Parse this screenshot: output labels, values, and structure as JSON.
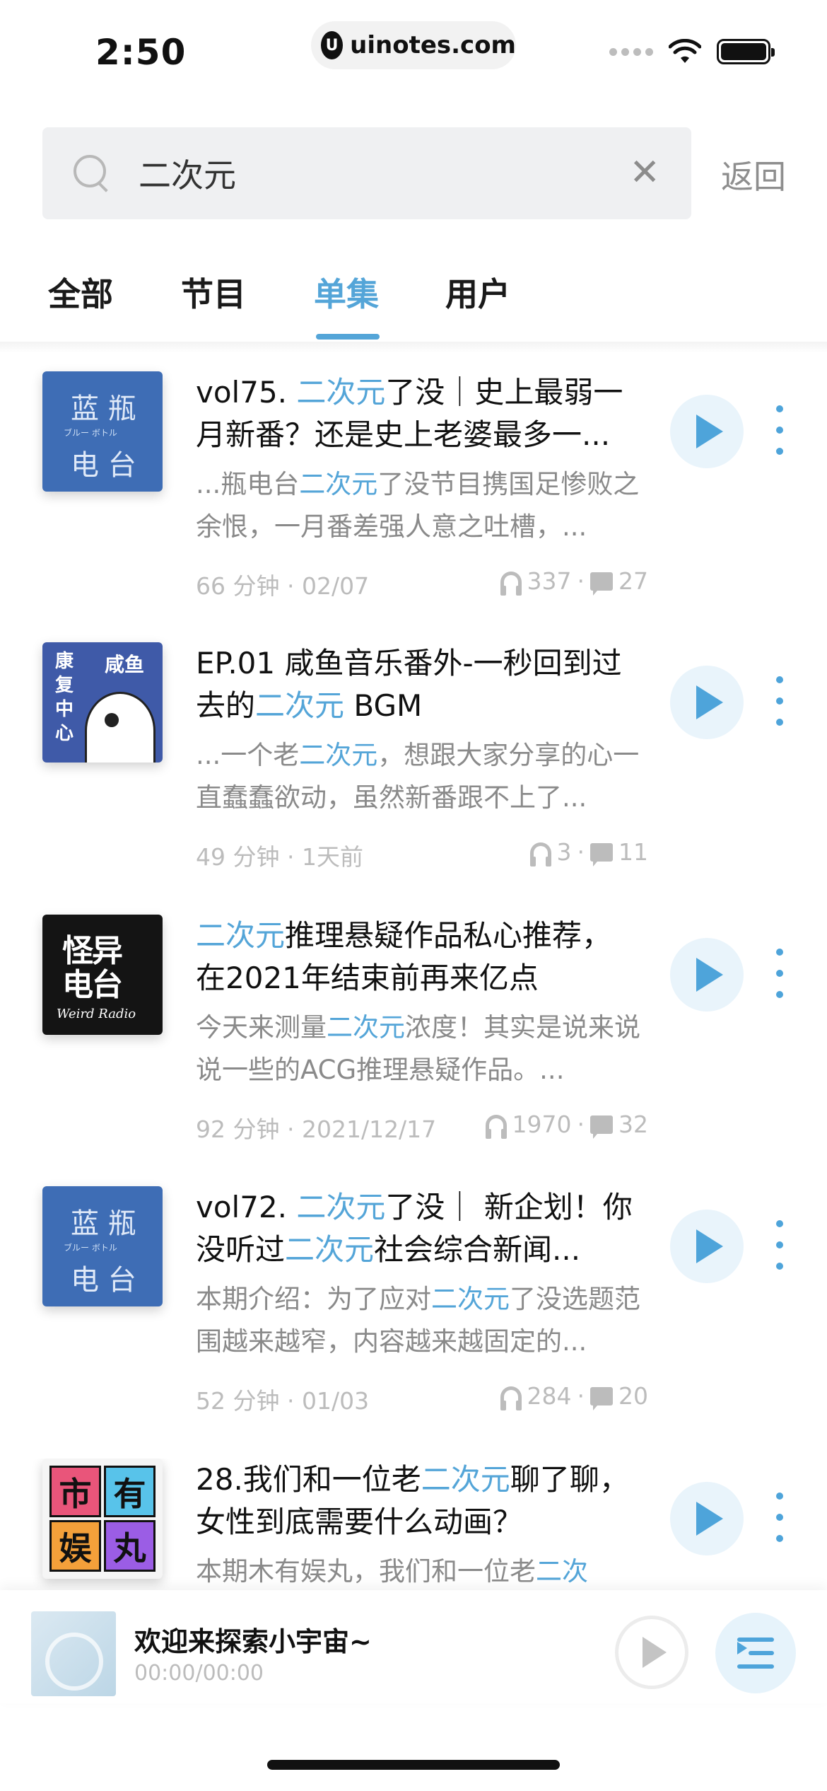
{
  "status": {
    "time": "2:50",
    "url": "uinotes.com"
  },
  "search": {
    "value": "二次元",
    "back_label": "返回"
  },
  "tabs": [
    {
      "label": "全部"
    },
    {
      "label": "节目"
    },
    {
      "label": "单集"
    },
    {
      "label": "用户"
    }
  ],
  "highlight_color": "#54a5d8",
  "episodes": [
    {
      "title_parts": [
        "vol75. ",
        "二次元",
        "了没｜史上最弱一月新番？还是史上老婆最多一..."
      ],
      "desc_parts": [
        "...瓶电台",
        "二次元",
        "了没节目携国足惨败之余恨，一月番差强人意之吐槽，..."
      ],
      "duration": "66 分钟",
      "date": "02/07",
      "plays": "337",
      "comments": "27",
      "cover": {
        "line1": "蓝 瓶",
        "line2": "电 台",
        "small": "ブルー ボトル"
      }
    },
    {
      "title_parts": [
        "EP.01 咸鱼音乐番外-一秒回到过去的",
        "二次元",
        " BGM"
      ],
      "desc_parts": [
        "...一个老",
        "二次元",
        "，想跟大家分享的心一直蠢蠢欲动，虽然新番跟不上了..."
      ],
      "duration": "49 分钟",
      "date": "1天前",
      "plays": "3",
      "comments": "11",
      "cover": {
        "left": "康复中心",
        "right": "咸鱼"
      }
    },
    {
      "title_parts": [
        "",
        "二次元",
        "推理悬疑作品私心推荐， 在2021年结束前再来亿点"
      ],
      "desc_parts": [
        "今天来测量",
        "二次元",
        "浓度！其实是说来说说一些的ACG推理悬疑作品。..."
      ],
      "duration": "92 分钟",
      "date": "2021/12/17",
      "plays": "1970",
      "comments": "32",
      "cover": {
        "main": "怪异电台",
        "script": "Weird Radio"
      }
    },
    {
      "title_parts": [
        "vol72. ",
        "二次元",
        "了没｜ 新企划！你没听过",
        "二次元",
        "社会综合新闻..."
      ],
      "desc_parts": [
        "本期介绍：为了应对",
        "二次元",
        "了没选题范围越来越窄，内容越来越固定的..."
      ],
      "duration": "52 分钟",
      "date": "01/03",
      "plays": "284",
      "comments": "20",
      "cover": {
        "line1": "蓝 瓶",
        "line2": "电 台",
        "small": "ブルー ボトル"
      }
    },
    {
      "title_parts": [
        "28.我们和一位老",
        "二次元",
        "聊了聊，女性到底需要什么动画？"
      ],
      "desc_parts": [
        "本期木有娱丸，我们和一位老",
        "二次",
        ""
      ],
      "cover": {
        "cells": [
          "市",
          "有",
          "娱",
          "丸"
        ]
      }
    }
  ],
  "mini_player": {
    "title": "欢迎来探索小宇宙~",
    "time": "00:00/00:00"
  }
}
